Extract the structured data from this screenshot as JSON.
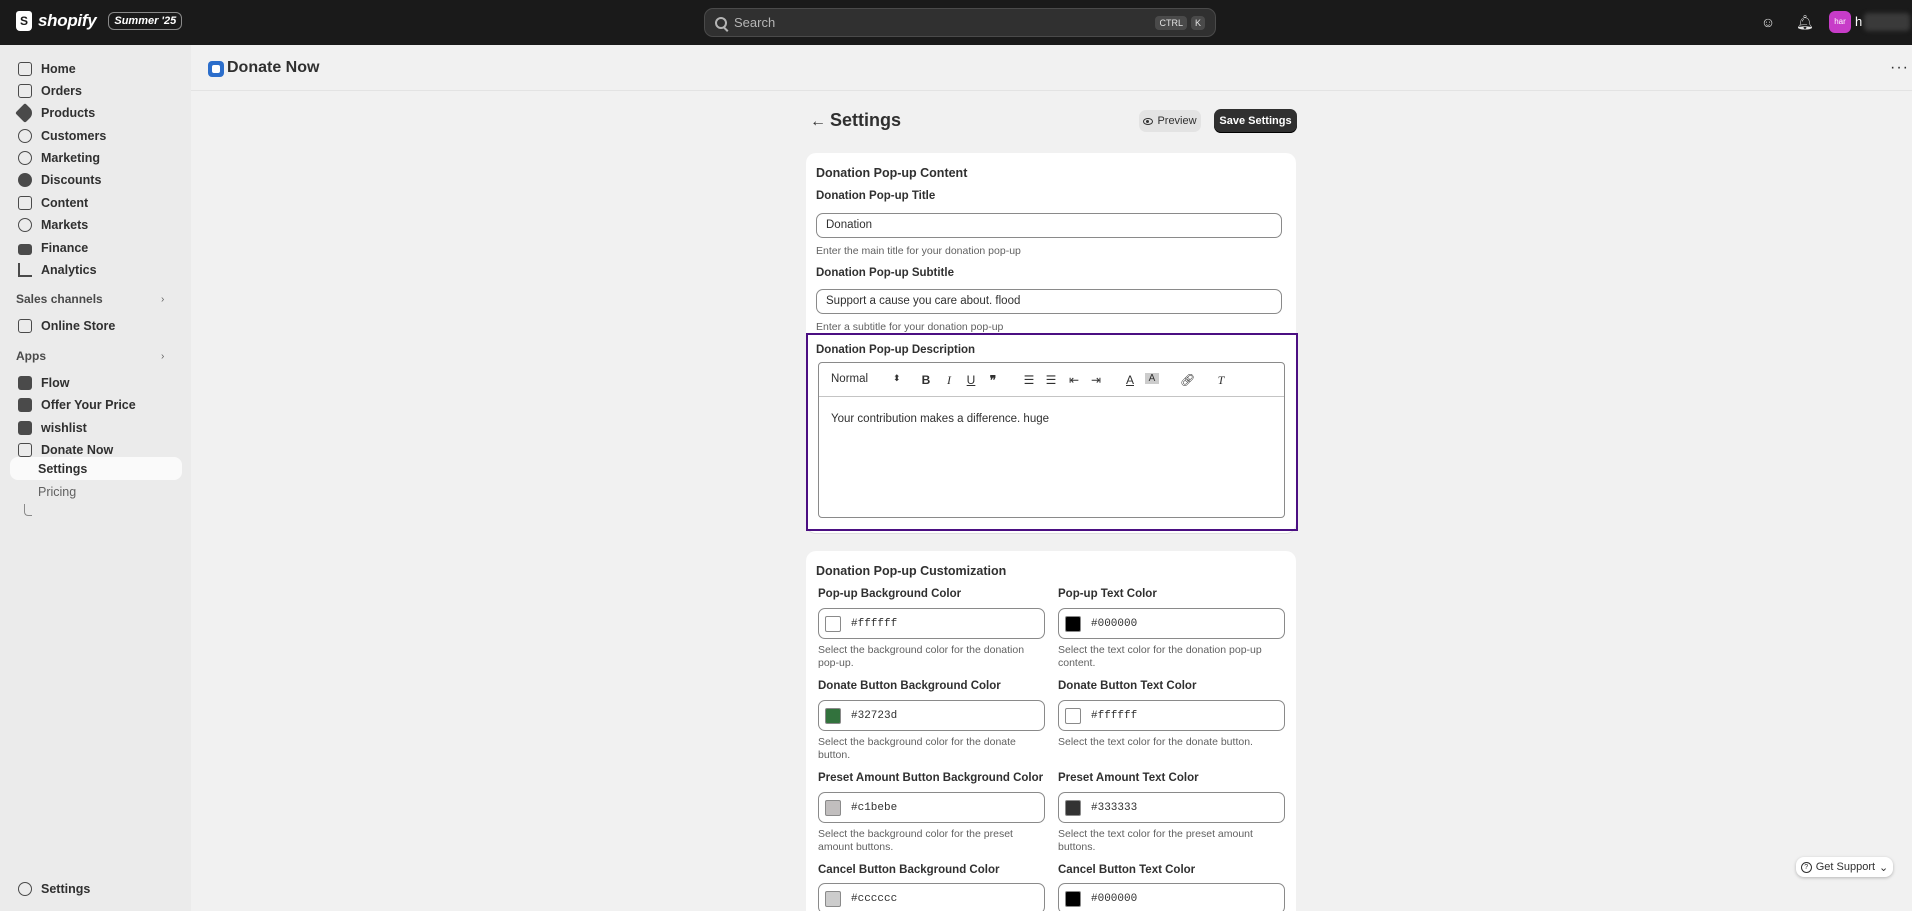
{
  "topbar": {
    "brand": "shopify",
    "edition_badge": "Summer '25",
    "search_placeholder": "Search",
    "shortcut_ctrl": "CTRL",
    "shortcut_key": "K",
    "avatar_initials": "har",
    "account_initial": "h"
  },
  "sidebar": {
    "main_items": [
      {
        "label": "Home",
        "icon": "home-icon"
      },
      {
        "label": "Orders",
        "icon": "orders-icon"
      },
      {
        "label": "Products",
        "icon": "tag-icon"
      },
      {
        "label": "Customers",
        "icon": "person-icon"
      },
      {
        "label": "Marketing",
        "icon": "target-icon"
      },
      {
        "label": "Discounts",
        "icon": "discount-icon"
      },
      {
        "label": "Content",
        "icon": "content-icon"
      },
      {
        "label": "Markets",
        "icon": "globe-icon"
      },
      {
        "label": "Finance",
        "icon": "bank-icon"
      },
      {
        "label": "Analytics",
        "icon": "chart-icon"
      }
    ],
    "sales_channels_label": "Sales channels",
    "online_store": "Online Store",
    "apps_label": "Apps",
    "apps": [
      "Flow",
      "Offer Your Price",
      "wishlist",
      "Donate Now"
    ],
    "app_sub_items": [
      "Settings",
      "Pricing"
    ],
    "footer_settings": "Settings"
  },
  "app_header": {
    "title": "Donate Now"
  },
  "page": {
    "title": "Settings",
    "preview_label": "Preview",
    "save_label": "Save Settings"
  },
  "content_card": {
    "title": "Donation Pop-up Content",
    "popup_title_label": "Donation Pop-up Title",
    "popup_title_value": "Donation",
    "popup_title_help": "Enter the main title for your donation pop-up",
    "popup_subtitle_label": "Donation Pop-up Subtitle",
    "popup_subtitle_value": "Support a cause you care about. flood",
    "popup_subtitle_help": "Enter a subtitle for your donation pop-up",
    "description_label": "Donation Pop-up Description",
    "editor_format": "Normal",
    "description_value": "Your contribution makes a difference. huge"
  },
  "customization_card": {
    "title": "Donation Pop-up Customization",
    "fields": [
      {
        "label": "Pop-up Background Color",
        "value": "#ffffff",
        "help": "Select the background color for the donation pop-up."
      },
      {
        "label": "Pop-up Text Color",
        "value": "#000000",
        "help": "Select the text color for the donation pop-up content."
      },
      {
        "label": "Donate Button Background Color",
        "value": "#32723d",
        "help": "Select the background color for the donate button."
      },
      {
        "label": "Donate Button Text Color",
        "value": "#ffffff",
        "help": "Select the text color for the donate button."
      },
      {
        "label": "Preset Amount Button Background Color",
        "value": "#c1bebe",
        "help": "Select the background color for the preset amount buttons."
      },
      {
        "label": "Preset Amount Text Color",
        "value": "#333333",
        "help": "Select the text color for the preset amount buttons."
      },
      {
        "label": "Cancel Button Background Color",
        "value": "#cccccc",
        "help": ""
      },
      {
        "label": "Cancel Button Text Color",
        "value": "#000000",
        "help": ""
      }
    ]
  },
  "support": {
    "label": "Get Support"
  },
  "colors": {
    "topbar": "#1a1a1a",
    "primary_button": "#303030",
    "focus_outline": "#4b0f82",
    "avatar": "#c73cc8"
  }
}
